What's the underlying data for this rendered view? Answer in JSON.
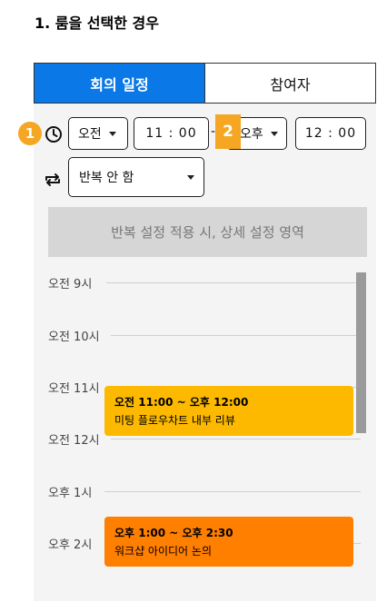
{
  "heading": "1. 룸을 선택한 경우",
  "tabs": [
    {
      "label": "회의 일정",
      "active": true
    },
    {
      "label": "참여자",
      "active": false
    }
  ],
  "badges": {
    "start": "1",
    "end": "2"
  },
  "time": {
    "icon": "clock-icon",
    "start_ampm": "오전",
    "start_time": "11 : 00",
    "separator": "-",
    "end_ampm": "오후",
    "end_time": "12 : 00"
  },
  "repeat": {
    "icon": "repeat-icon",
    "value": "반복 안 함",
    "info": "반복 설정 적용 시, 상세 설정 영역"
  },
  "timeline": {
    "labels": [
      "오전 9시",
      "오전 10시",
      "오전 11시",
      "오전 12시",
      "오후 1시",
      "오후 2시"
    ]
  },
  "events": [
    {
      "time": "오전 11:00 ~ 오후 12:00",
      "title": "미팅 플로우차트 내부 리뷰",
      "color": "#fcb900"
    },
    {
      "time": "오후 1:00 ~ 오후 2:30",
      "title": "워크샵 아이디어 논의",
      "color": "#ff7f00"
    }
  ],
  "colors": {
    "accent": "#0a78e6",
    "badge": "#f5a623"
  }
}
